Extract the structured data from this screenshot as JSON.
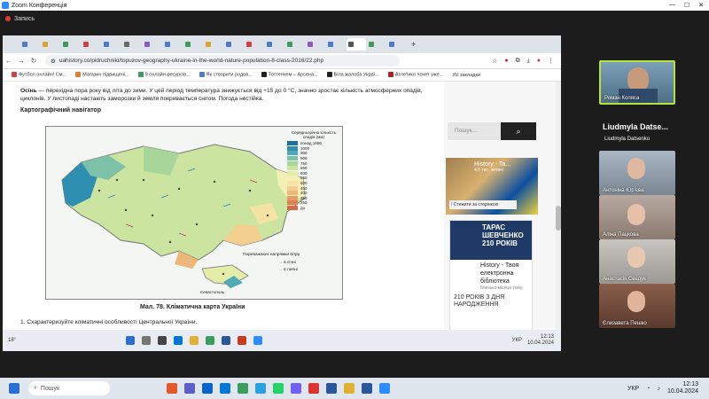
{
  "zoom": {
    "title": "Zoom Конференція",
    "recording_label": "Запись"
  },
  "browser": {
    "url": "uahistory.co/pidruchniki/topuzov-geography-ukraine-in-the-world-nature-population-8-class-2016/22.php",
    "bookmarks": [
      "Футбол онлайн! См...",
      "Магазин підвищені...",
      "9 онлайн-ресурсів...",
      "Як створити родов...",
      "Тоттенхем – Арсена...",
      "Біла жалоба Украї...",
      "Атлетико почет уже...",
      "Усі закладки"
    ]
  },
  "article": {
    "autumn_label": "Осінь",
    "autumn_text": " — перехідна пора року від літа до зими. У цей період температура знижується від +15 до 0 °С, значно зростає кількість атмосферних опадів, циклонів. У листопаді настають заморозки й земля покривається снігом. Погода нестійка.",
    "section_title": "Картографічний навігатор",
    "map_caption": "Мал. 78. Кліматична карта України",
    "question1": "1. Схарактеризуйте кліматичні особливості Центральної України."
  },
  "map": {
    "legend_title": "Середньорічна кількість опадів (мм)",
    "legend_items": [
      "понад 1000",
      "1000",
      "900",
      "800",
      "750",
      "650",
      "600",
      "550",
      "500",
      "450",
      "400",
      "350",
      "250",
      "до"
    ],
    "legend_colors": [
      "#1f6f9e",
      "#2f8fb0",
      "#4fa9b6",
      "#7cc1a8",
      "#a8d59a",
      "#cbe4a0",
      "#e4eda8",
      "#f3efb6",
      "#f5e3a6",
      "#f2cf8f",
      "#ecb778",
      "#e59b62",
      "#dc7f52",
      "#d46a48"
    ],
    "wind_title": "Переважаючі напрямки вітру",
    "wind_jan": "в січні",
    "wind_jul": "в липні",
    "city_label": "Севастополь"
  },
  "sidebar": {
    "search_placeholder": "Пошук...",
    "fb_page_name": "History - Ta...",
    "fb_followers": "4,5 тис. читачі",
    "fb_follow": "Стежити за сторінкою",
    "banner_text": "ТАРАС ШЕВЧЕНКО 210 РОКІВ",
    "feed_title": "History - Твоя електронна бібліотека",
    "feed_sub": "близько місяця тому",
    "feed_post": "210 РОКІВ З ДНЯ НАРОДЖЕННЯ"
  },
  "inner_taskbar": {
    "lang": "УКР",
    "time": "12:13",
    "date": "10.04.2024",
    "temp": "18°"
  },
  "participants": [
    {
      "name": "Роман Коляса",
      "type": "video"
    },
    {
      "name": "Liudmyla Datse...",
      "sub": "Liudmyla Datsenko",
      "type": "name"
    },
    {
      "name": "Антоніна Юр'єва",
      "type": "video"
    },
    {
      "name": "Аліна Пацкова",
      "type": "video"
    },
    {
      "name": "Анастасія Сведук",
      "type": "video"
    },
    {
      "name": "Єлизавета Пешко",
      "type": "video"
    }
  ],
  "taskbar": {
    "search_label": "Пошук",
    "lang": "УКР",
    "time": "12:13",
    "date": "10.04.2024"
  }
}
